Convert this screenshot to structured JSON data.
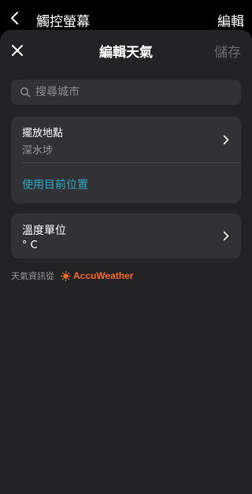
{
  "topbar": {
    "back_icon": "chevron-left-icon",
    "title": "觸控螢幕",
    "edit_label": "編輯"
  },
  "sheet": {
    "close_icon": "close-icon",
    "title": "編輯天氣",
    "save_label": "儲存"
  },
  "search": {
    "placeholder": "搜尋城市",
    "value": ""
  },
  "location": {
    "label": "擺放地點",
    "value": "深水埗",
    "use_current_label": "使用目前位置"
  },
  "temperature": {
    "label": "溫度單位",
    "value": "° C"
  },
  "attribution": {
    "text": "天氣資訊從",
    "provider": "AccuWeather"
  },
  "colors": {
    "background": "#000000",
    "sheet": "#232325",
    "card": "#323235",
    "accent_link": "#2ba9c9",
    "brand_orange": "#f26b21",
    "disabled_text": "#6b6b6e"
  }
}
